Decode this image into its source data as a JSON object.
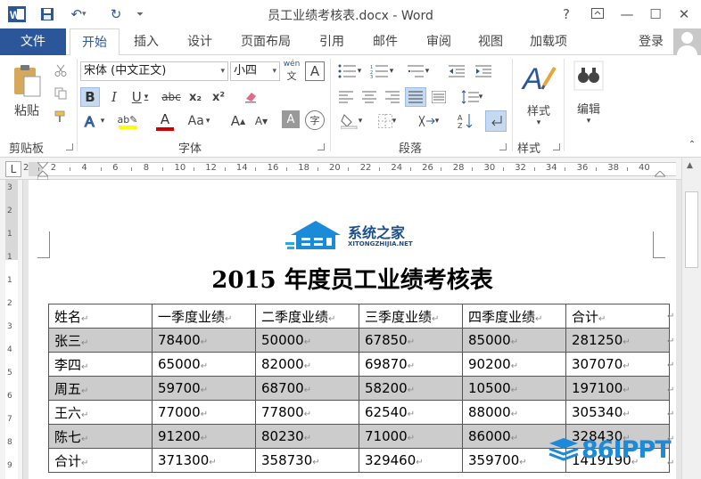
{
  "window": {
    "title": "员工业绩考核表.docx - Word",
    "help": "?",
    "minimize": "—",
    "restore": "☐",
    "close": "✕"
  },
  "qat": {
    "word_icon": "W",
    "save_icon": "save-icon",
    "undo_icon": "↶",
    "redo_icon": "↻",
    "customize_icon": "⏷"
  },
  "tabs": [
    "文件",
    "开始",
    "插入",
    "设计",
    "页面布局",
    "引用",
    "邮件",
    "审阅",
    "视图",
    "加载项"
  ],
  "account": {
    "login": "登录"
  },
  "ribbon": {
    "clipboard": {
      "label": "剪贴板",
      "paste": "粘贴"
    },
    "font": {
      "label": "字体",
      "font_name": "宋体 (中文正文)",
      "font_size": "小四",
      "wen": "wén",
      "a_box": "A",
      "bold": "B",
      "italic": "I",
      "underline": "U",
      "strike": "abc",
      "sub": "x₂",
      "sup": "x²",
      "aa": "Aa",
      "grow": "A",
      "shrink": "A",
      "char_shade": "A",
      "enclose": "字"
    },
    "paragraph": {
      "label": "段落"
    },
    "styles": {
      "label": "样式",
      "button": "样式"
    },
    "editing": {
      "button": "编辑"
    }
  },
  "ruler": {
    "ticks": [
      "2",
      "2",
      "4",
      "6",
      "8",
      "10",
      "12",
      "14",
      "16",
      "18",
      "20",
      "22",
      "24",
      "26",
      "28",
      "30",
      "32",
      "34",
      "36",
      "38",
      "40"
    ],
    "vticks": [
      "3",
      "2",
      "1",
      "1",
      "1",
      "2",
      "3",
      "4",
      "5",
      "6",
      "7",
      "8",
      "9",
      "10"
    ]
  },
  "document": {
    "logo_text": "系统之家",
    "logo_sub": "XITONGZHIJIA.NET",
    "title": "2015 年度员工业绩考核表",
    "paragraph_mark": "↵",
    "table": {
      "header": [
        "姓名",
        "一季度业绩",
        "二季度业绩",
        "三季度业绩",
        "四季度业绩",
        "合计"
      ],
      "rows": [
        [
          "张三",
          "78400",
          "50000",
          "67850",
          "85000",
          "281250"
        ],
        [
          "李四",
          "65000",
          "82000",
          "69870",
          "90200",
          "307070"
        ],
        [
          "周五",
          "59700",
          "68700",
          "58200",
          "10500",
          "197100"
        ],
        [
          "王六",
          "77000",
          "77800",
          "62540",
          "88000",
          "305340"
        ],
        [
          "陈七",
          "91200",
          "80230",
          "71000",
          "86000",
          "328430"
        ],
        [
          "合计",
          "371300",
          "358730",
          "329460",
          "359700",
          "1419190"
        ]
      ]
    }
  },
  "watermark": {
    "text": "86IPPT"
  },
  "colors": {
    "brand": "#2b579a",
    "shade": "#cccccc",
    "logo_blue": "#1b8ad9"
  }
}
